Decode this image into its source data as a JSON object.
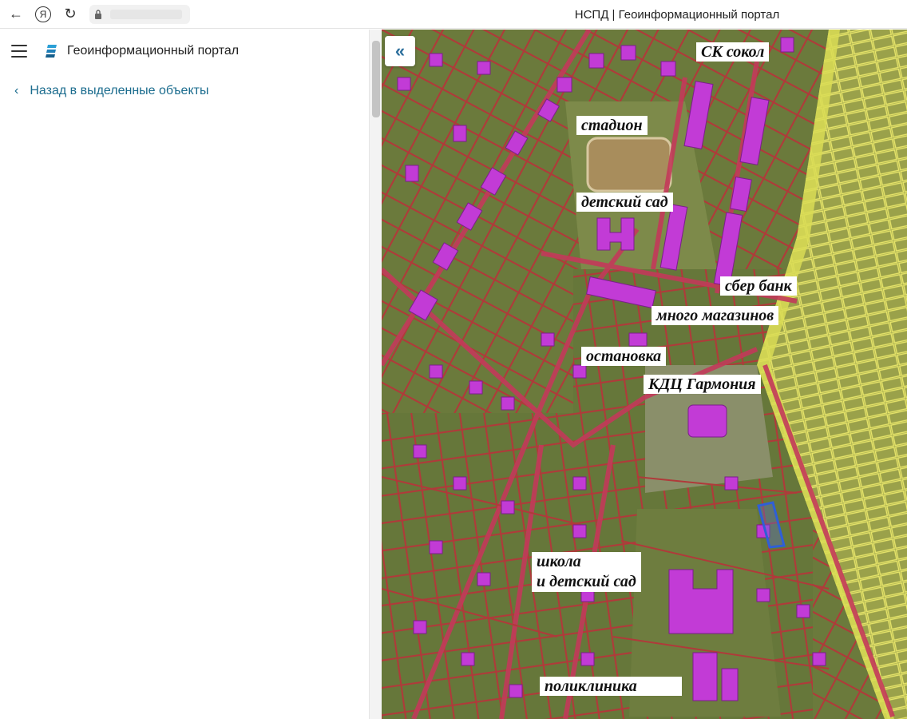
{
  "browser": {
    "back_glyph": "←",
    "yandex_glyph": "Я",
    "reload_glyph": "↻",
    "page_title": "НСПД | Геоинформационный портал"
  },
  "panel": {
    "portal_name": "Геоинформационный портал",
    "back_link_label": "Назад в выделенные объекты",
    "back_chevron": "‹"
  },
  "map": {
    "collapse_glyph": "«",
    "labels": {
      "sk_sokol": "СК сокол",
      "stadion": "стадион",
      "detsky_sad": "детский сад",
      "sber_bank": "сбер банк",
      "mnogo_magazinov": "много магазинов",
      "ostanovka": "остановка",
      "kdc_garmonia": "КДЦ Гармония",
      "shkola_line1": "школа",
      "shkola_line2": "и детский сад",
      "poliklinika": "поликлиника"
    },
    "colors": {
      "building": "#c23bd6",
      "parcel_line": "#b03a3a",
      "forest_zone": "#e0e36a",
      "selected_parcel": "#2f5fd6",
      "accent_link": "#1b6c8e"
    }
  }
}
